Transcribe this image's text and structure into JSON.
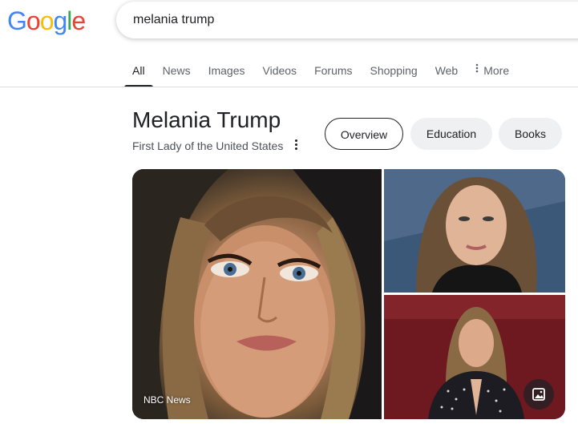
{
  "logo": {
    "letters": [
      "G",
      "o",
      "o",
      "g",
      "l",
      "e"
    ],
    "colors": [
      "#4285F4",
      "#EA4335",
      "#FBBC05",
      "#4285F4",
      "#34A853",
      "#EA4335"
    ]
  },
  "search": {
    "query": "melania trump"
  },
  "tabs": [
    {
      "label": "All",
      "active": true
    },
    {
      "label": "News"
    },
    {
      "label": "Images"
    },
    {
      "label": "Videos"
    },
    {
      "label": "Forums"
    },
    {
      "label": "Shopping"
    },
    {
      "label": "Web"
    }
  ],
  "more_tab": {
    "label": "More",
    "icon": "vertical-dots-icon"
  },
  "knowledge_panel": {
    "title": "Melania Trump",
    "subtitle": "First Lady of the United States",
    "menu_icon": "more-vert-icon",
    "chips": [
      "Overview",
      "Education",
      "Books"
    ],
    "images": {
      "main_source": "NBC News",
      "search_button_icon": "image-search-icon"
    }
  },
  "colors": {
    "text_primary": "#202124",
    "text_secondary": "#5f6368",
    "chip_bg": "#eef0f2",
    "divider": "#dadce0"
  }
}
